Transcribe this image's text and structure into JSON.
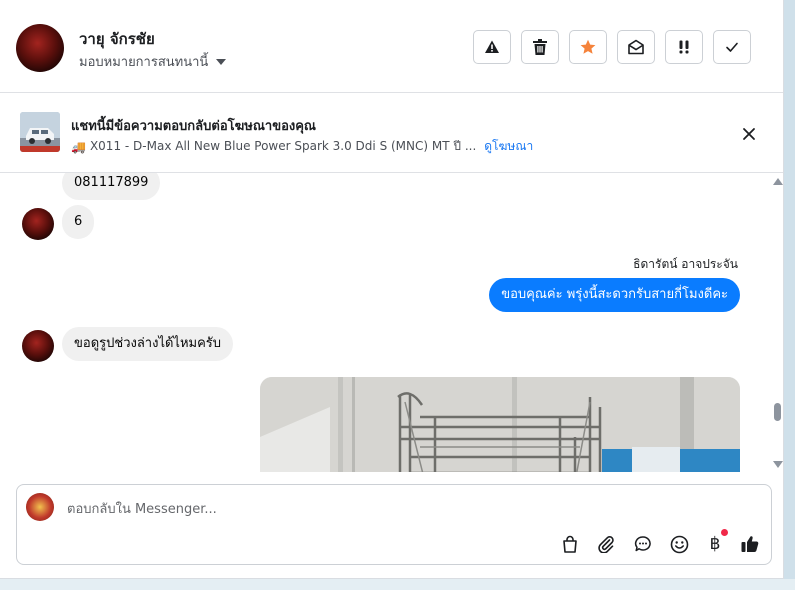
{
  "header": {
    "contact_name": "วายุ จักรชัย",
    "assign_label": "มอบหมายการสนทนานี้",
    "tools": [
      {
        "name": "report-button",
        "icon": "warning-icon"
      },
      {
        "name": "delete-button",
        "icon": "trash-icon"
      },
      {
        "name": "star-button",
        "icon": "star-icon",
        "color": "#f5833b"
      },
      {
        "name": "mark-unread-button",
        "icon": "open-envelope-icon"
      },
      {
        "name": "follow-up-button",
        "icon": "exclamation-icon"
      },
      {
        "name": "mark-done-button",
        "icon": "check-icon"
      }
    ]
  },
  "ad_banner": {
    "title": "แชทนี้มีข้อความตอบกลับต่อโฆษณาของคุณ",
    "ad_text": "X011 - D-Max All New Blue Power Spark 3.0 Ddi S (MNC) MT ปี ...",
    "link": "ดูโฆษณา"
  },
  "messages": {
    "m1": "081117899",
    "m2": "6",
    "sender": "ธิดารัตน์ อาจประจัน",
    "m3": "ขอบคุณค่ะ พรุ่งนี้สะดวกรับสายกี่โมงดีคะ",
    "m4": "ขอดูรูปช่วงล่างได้ไหมครับ"
  },
  "composer": {
    "placeholder": "ตอบกลับใน Messenger...",
    "icons": [
      "bag-icon",
      "paperclip-icon",
      "chat-bubble-icon",
      "smiley-icon",
      "baht-icon",
      "thumbs-up-icon"
    ],
    "baht_symbol": "฿"
  },
  "colors": {
    "accent": "#0a7cff",
    "link": "#1877f2",
    "star": "#f5833b",
    "notify_dot": "#f02849"
  }
}
